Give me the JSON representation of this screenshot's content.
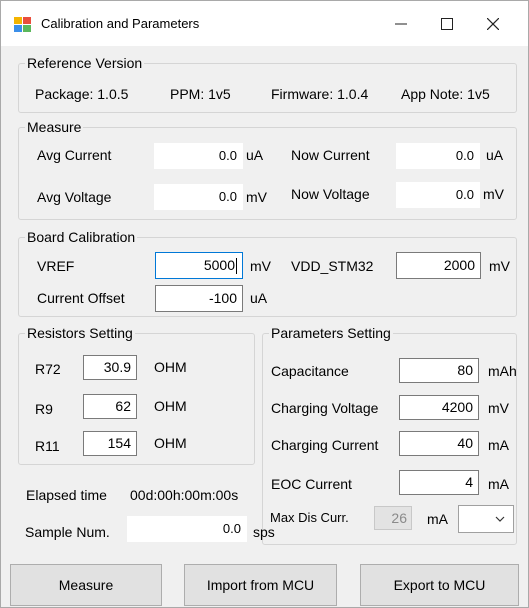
{
  "window": {
    "title": "Calibration and Parameters",
    "min_glyph": "—",
    "max_glyph": "☐",
    "close_glyph": "✕"
  },
  "reference_version": {
    "legend": "Reference Version",
    "package": "Package: 1.0.5",
    "ppm": "PPM: 1v5",
    "firmware": "Firmware:  1.0.4",
    "app_note": "App Note: 1v5"
  },
  "measure": {
    "legend": "Measure",
    "avg_current_label": "Avg Current",
    "avg_current_value": "0.0",
    "avg_current_unit": "uA",
    "now_current_label": "Now Current",
    "now_current_value": "0.0",
    "now_current_unit": "uA",
    "avg_voltage_label": "Avg Voltage",
    "avg_voltage_value": "0.0",
    "avg_voltage_unit": "mV",
    "now_voltage_label": "Now Voltage",
    "now_voltage_value": "0.0",
    "now_voltage_unit": "mV"
  },
  "board_calibration": {
    "legend": "Board Calibration",
    "vref_label": "VREF",
    "vref_value": "5000",
    "vref_unit": "mV",
    "vdd_label": "VDD_STM32",
    "vdd_value": "2000",
    "vdd_unit": "mV",
    "offset_label": "Current Offset",
    "offset_value": "-100",
    "offset_unit": "uA"
  },
  "resistors": {
    "legend": "Resistors Setting",
    "items": [
      {
        "label": "R72",
        "value": "30.9",
        "unit": "OHM"
      },
      {
        "label": "R9",
        "value": "62",
        "unit": "OHM"
      },
      {
        "label": "R11",
        "value": "154",
        "unit": "OHM"
      }
    ]
  },
  "parameters": {
    "legend": "Parameters Setting",
    "items": [
      {
        "label": "Capacitance",
        "value": "80",
        "unit": "mAh"
      },
      {
        "label": "Charging Voltage",
        "value": "4200",
        "unit": "mV"
      },
      {
        "label": "Charging Current",
        "value": "40",
        "unit": "mA"
      },
      {
        "label": "EOC Current",
        "value": "4",
        "unit": "mA"
      }
    ],
    "max_dis_label": "Max Dis Curr.",
    "max_dis_value": "26",
    "max_dis_unit": "mA",
    "max_dis_select": ""
  },
  "status": {
    "elapsed_label": "Elapsed time",
    "elapsed_value": "00d:00h:00m:00s",
    "sample_label": "Sample Num.",
    "sample_value": "0.0",
    "sample_unit": "sps"
  },
  "buttons": {
    "measure": "Measure",
    "import": "Import from MCU",
    "export": "Export to MCU"
  },
  "colors": {
    "focus": "#0078d7",
    "window_bg": "#f0f0f0"
  }
}
